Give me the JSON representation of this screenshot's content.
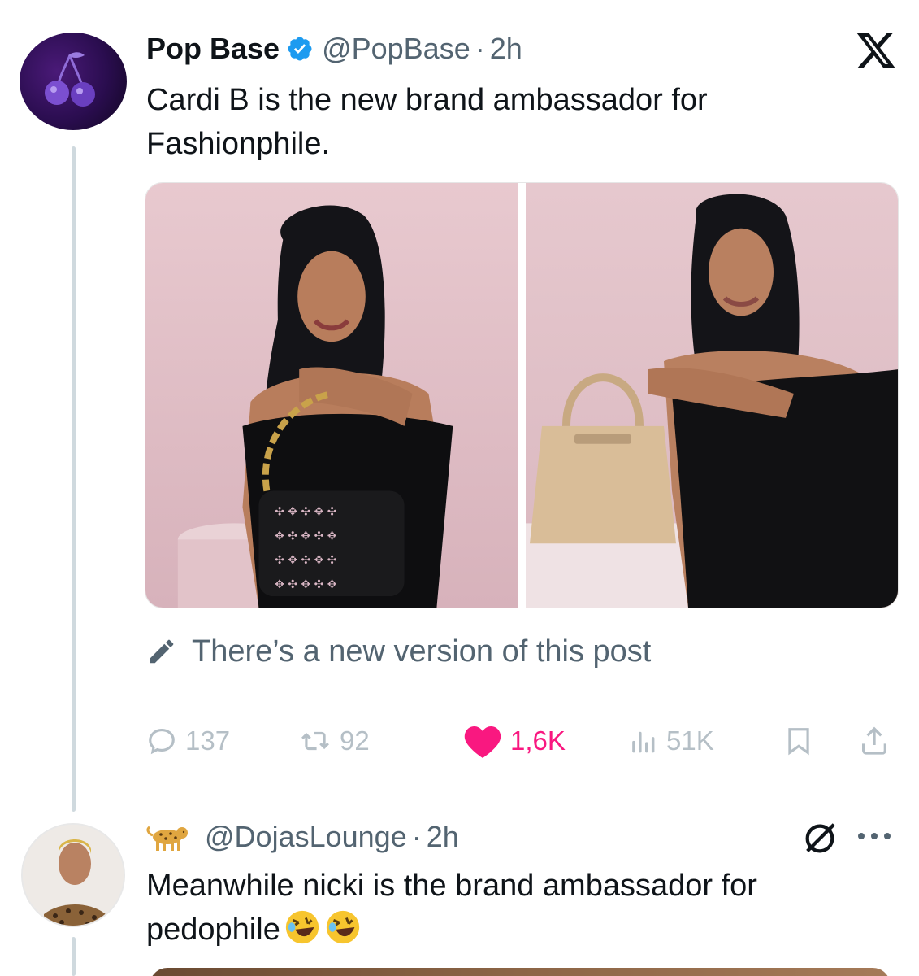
{
  "tweet1": {
    "display_name": "Pop Base",
    "handle": "@PopBase",
    "separator": "·",
    "time": "2h",
    "text": "Cardi B is the new brand ambassador for Fashionphile.",
    "avatar_icon": "cherry-icon",
    "platform_logo": "x-logo-icon",
    "notice": "There’s a new version of this post",
    "actions": {
      "replies": "137",
      "reposts": "92",
      "likes": "1,6K",
      "views": "51K"
    },
    "colors": {
      "like": "#f91880",
      "verified": "#1d9bf0",
      "muted": "#536471"
    }
  },
  "tweet2": {
    "handle": "@DojasLounge",
    "separator": "·",
    "time": "2h",
    "text": "Meanwhile nicki is the brand ambassador for pedophile",
    "emojis": [
      "rolling-on-floor-laughing-emoji",
      "rolling-on-floor-laughing-emoji"
    ],
    "name_icon": "leopard-icon"
  }
}
